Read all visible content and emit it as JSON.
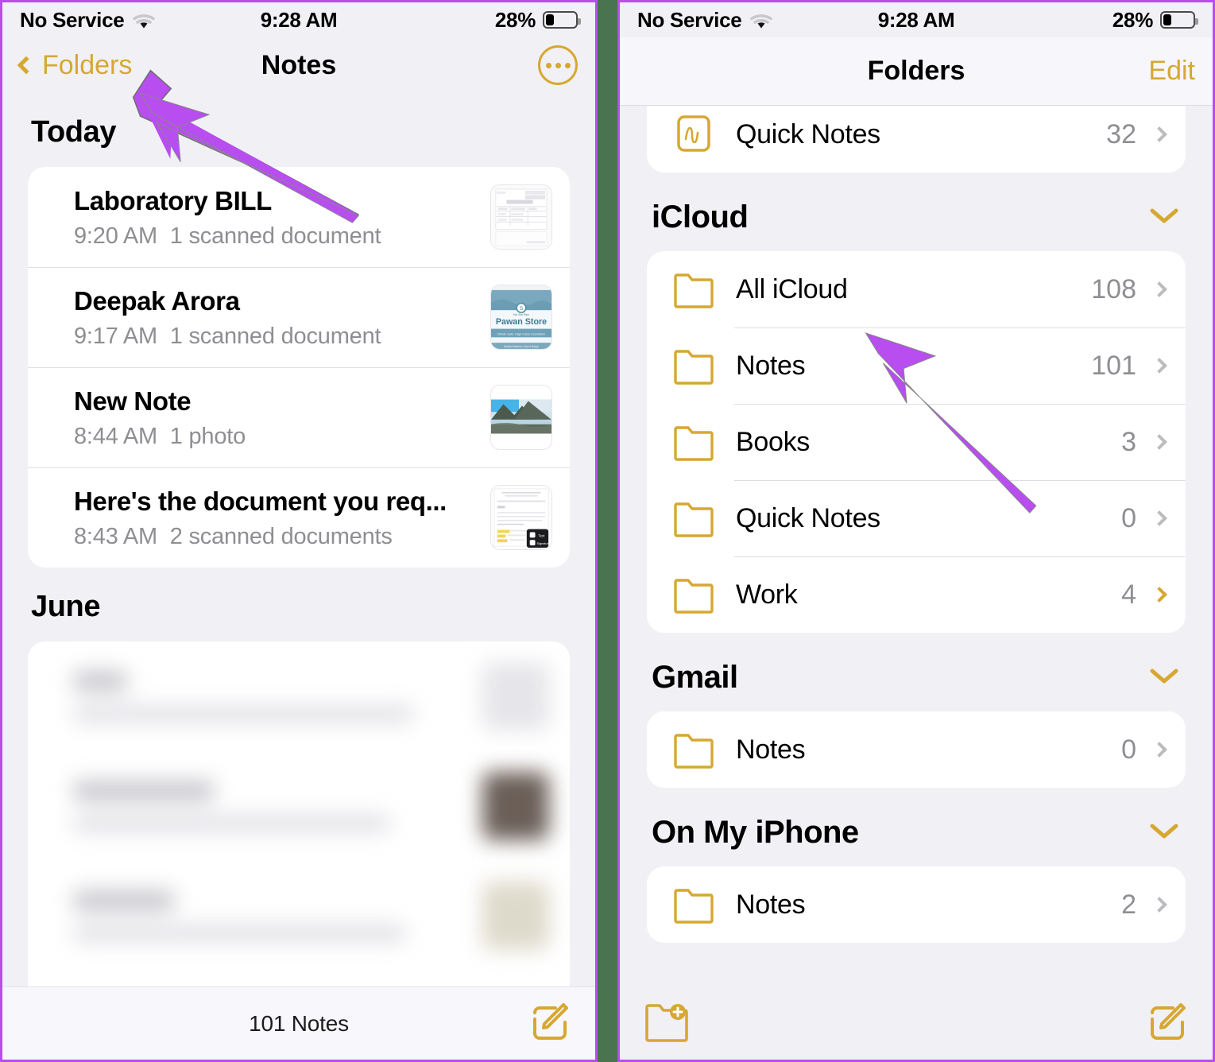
{
  "divider": {
    "color": "#4a7350"
  },
  "accent": {
    "gold": "#d6a832",
    "arrow": "#b84df0",
    "muted": "#8e8e93"
  },
  "left_phone": {
    "status_bar": {
      "carrier": "No Service",
      "wifi": "wifi-icon",
      "time": "9:28 AM",
      "battery_percent": "28%"
    },
    "nav": {
      "back_label": "Folders",
      "title": "Notes",
      "more_label": "more-options"
    },
    "sections": [
      {
        "header": "Today",
        "notes": [
          {
            "title": "Laboratory BILL",
            "time": "9:20 AM",
            "detail": "1 scanned document",
            "thumb": "patient-bill-scan"
          },
          {
            "title": "Deepak Arora",
            "time": "9:17 AM",
            "detail": "1 scanned document",
            "thumb": "pawan-store-scan"
          },
          {
            "title": "New Note",
            "time": "8:44 AM",
            "detail": "1 photo",
            "thumb": "mountain-photo"
          },
          {
            "title": "Here's the document you req...",
            "time": "8:43 AM",
            "detail": "2 scanned documents",
            "thumb": "signature-document-scan"
          }
        ]
      },
      {
        "header": "June",
        "notes": []
      }
    ],
    "partial_note_title": "12345",
    "toolbar": {
      "count_label": "101 Notes",
      "compose_label": "compose-note"
    }
  },
  "right_phone": {
    "status_bar": {
      "carrier": "No Service",
      "wifi": "wifi-icon",
      "time": "9:28 AM",
      "battery_percent": "28%"
    },
    "nav": {
      "title": "Folders",
      "edit_label": "Edit"
    },
    "top_row": {
      "label": "Quick Notes",
      "count": "32",
      "icon": "quick-notes-icon"
    },
    "groups": [
      {
        "title": "iCloud",
        "folders": [
          {
            "label": "All iCloud",
            "count": "108",
            "chevron": "gray"
          },
          {
            "label": "Notes",
            "count": "101",
            "chevron": "gray"
          },
          {
            "label": "Books",
            "count": "3",
            "chevron": "gray"
          },
          {
            "label": "Quick Notes",
            "count": "0",
            "chevron": "gray"
          },
          {
            "label": "Work",
            "count": "4",
            "chevron": "gold"
          }
        ]
      },
      {
        "title": "Gmail",
        "folders": [
          {
            "label": "Notes",
            "count": "0",
            "chevron": "gray"
          }
        ]
      },
      {
        "title": "On My iPhone",
        "folders": [
          {
            "label": "Notes",
            "count": "2",
            "chevron": "gray"
          }
        ]
      }
    ],
    "toolbar": {
      "new_folder_label": "new-folder",
      "compose_label": "compose-note"
    }
  }
}
